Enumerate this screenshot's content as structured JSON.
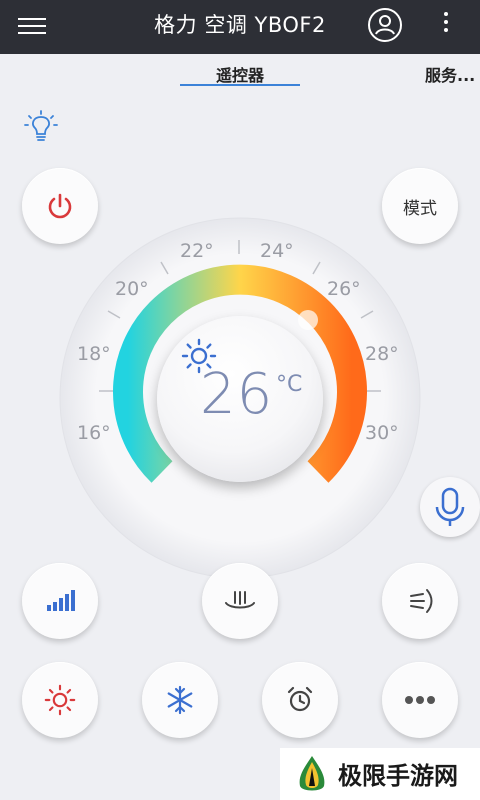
{
  "header": {
    "title": "格力 空调 YBOF2",
    "menu_icon": "hamburger-menu-icon",
    "user_icon": "user-account-icon",
    "more_icon": "vertical-dots-icon"
  },
  "tabs": [
    {
      "label": "遥控器",
      "active": true
    },
    {
      "label": "服务..."
    }
  ],
  "controls": {
    "light_icon": "bulb-icon",
    "power_icon": "power-icon",
    "mode_label": "模式",
    "mic_icon": "microphone-icon"
  },
  "dial": {
    "ticks": [
      "16°",
      "18°",
      "20°",
      "22°",
      "24°",
      "26°",
      "28°",
      "30°"
    ],
    "current_temp": "26",
    "unit": "°C",
    "mode_icon": "sun-icon"
  },
  "bottom_buttons": [
    {
      "icon": "fan-speed-icon"
    },
    {
      "icon": "airflow-down-icon"
    },
    {
      "icon": "swing-icon"
    },
    {
      "icon": "heat-sun-icon"
    },
    {
      "icon": "snowflake-icon"
    },
    {
      "icon": "alarm-clock-icon"
    },
    {
      "icon": "more-dots-icon"
    }
  ],
  "watermark": {
    "text": "极限手游网"
  },
  "colors": {
    "appbar": "#2d2f36",
    "accent": "#3b82d8",
    "power": "#d9393b",
    "cold": "#22d3e0",
    "warm": "#ffb23a",
    "hot": "#ff6a1a"
  }
}
